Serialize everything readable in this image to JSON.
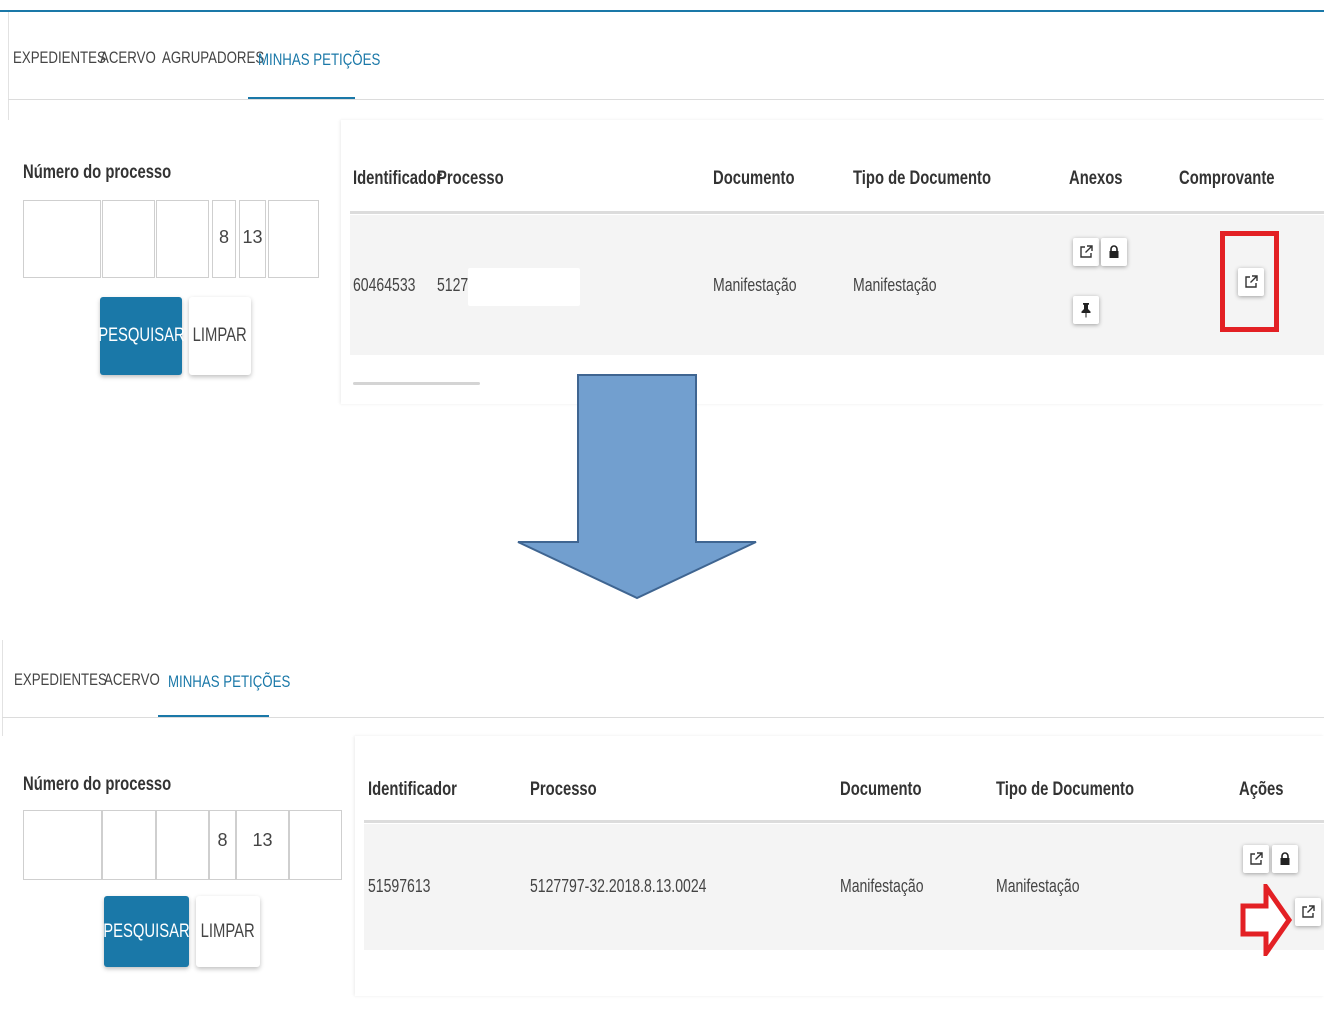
{
  "panel_before": {
    "tabs": [
      {
        "label": "EXPEDIENTES",
        "active": false
      },
      {
        "label": "ACERVO",
        "active": false
      },
      {
        "label": "AGRUPADORES",
        "active": false
      },
      {
        "label": "MINHAS PETIÇÕES",
        "active": true
      }
    ],
    "filter": {
      "title": "Número do processo",
      "segments": [
        "",
        "",
        "",
        "8",
        "13",
        ""
      ],
      "search_label": "PESQUISAR",
      "clear_label": "LIMPAR"
    },
    "table": {
      "columns": [
        "Identificador",
        "Processo",
        "Documento",
        "Tipo de Documento",
        "Anexos",
        "Comprovante"
      ],
      "rows": [
        {
          "identificador": "60464533",
          "processo": "51277",
          "documento": "Manifestação",
          "tipo_documento": "Manifestação",
          "anexos_icons": [
            "external-link-icon",
            "lock-icon",
            "pin-icon"
          ],
          "comprovante_icon": "external-link-icon"
        }
      ]
    },
    "highlight_color": "#e32024"
  },
  "transition_arrow": {
    "color": "#729fcf",
    "direction": "down"
  },
  "panel_after": {
    "tabs": [
      {
        "label": "EXPEDIENTES",
        "active": false
      },
      {
        "label": "ACERVO",
        "active": false
      },
      {
        "label": "MINHAS PETIÇÕES",
        "active": true
      }
    ],
    "filter": {
      "title": "Número do processo",
      "segments": [
        "",
        "",
        "",
        "8",
        "13",
        ""
      ],
      "search_label": "PESQUISAR",
      "clear_label": "LIMPAR"
    },
    "table": {
      "columns": [
        "Identificador",
        "Processo",
        "Documento",
        "Tipo de Documento",
        "Ações"
      ],
      "rows": [
        {
          "identificador": "51597613",
          "processo": "5127797-32.2018.8.13.0024",
          "documento": "Manifestação",
          "tipo_documento": "Manifestação",
          "acoes_icons": [
            "external-link-icon",
            "lock-icon",
            "external-link-icon"
          ]
        }
      ]
    },
    "pointer_arrow": {
      "color": "#e32024",
      "direction": "right"
    }
  },
  "colors": {
    "accent": "#1a78a8",
    "highlight": "#e32024",
    "arrow": "#729fcf"
  }
}
